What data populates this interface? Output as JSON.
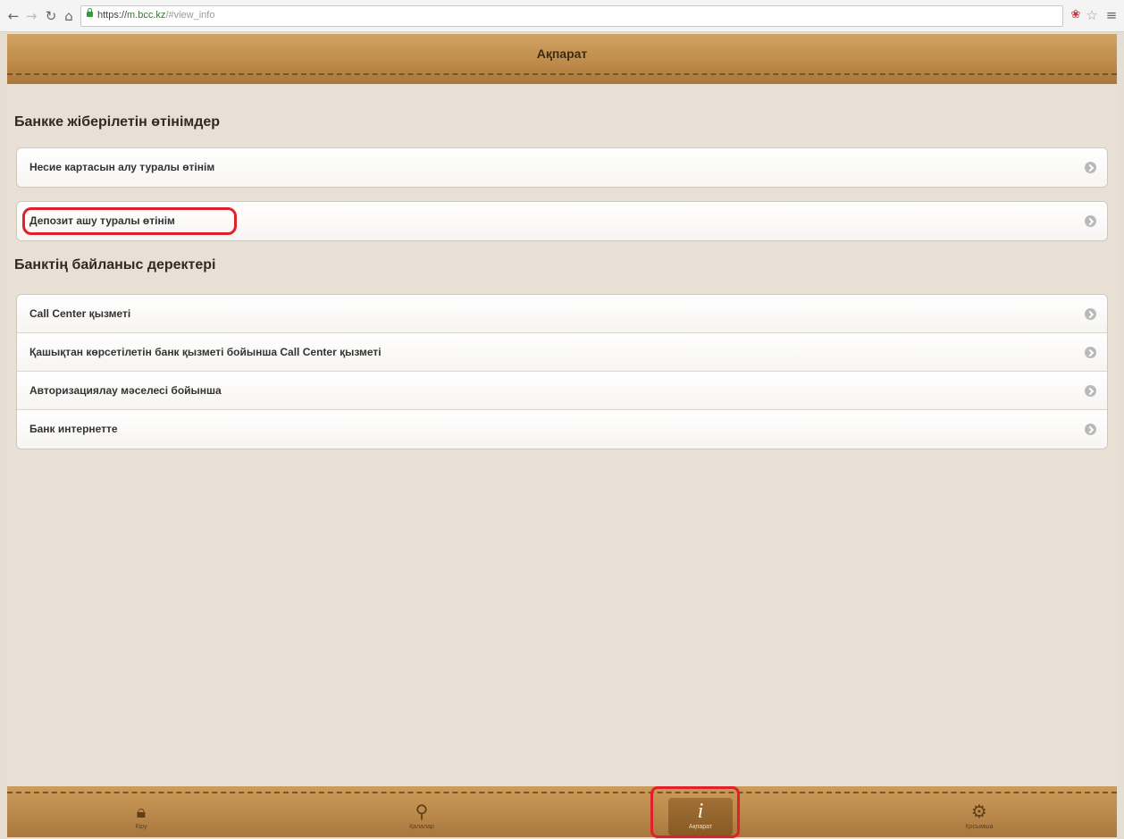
{
  "browser": {
    "url_scheme": "https://",
    "url_host": "m.bcc.kz",
    "url_path": "/#view_info",
    "icons": [
      "back-arrow-icon",
      "forward-arrow-icon",
      "reload-icon",
      "home-icon",
      "lock-icon",
      "extension-icon",
      "star-icon",
      "menu-icon"
    ]
  },
  "header": {
    "title": "Ақпарат"
  },
  "sections": [
    {
      "title": "Банкке жіберілетін өтінімдер",
      "items": [
        {
          "label": "Несие картасын алу туралы өтінім"
        },
        {
          "label": "Депозит ашу туралы өтінім"
        }
      ]
    },
    {
      "title": "Банктің байланыс деректері",
      "items": [
        {
          "label": "Call Center қызметі"
        },
        {
          "label": "Қашықтан көрсетілетін банк қызметі бойынша Call Center қызметі"
        },
        {
          "label": "Авторизациялау мәселесі бойынша"
        },
        {
          "label": "Банк интернетте"
        }
      ]
    }
  ],
  "tabs": [
    {
      "icon": "lock-icon",
      "label": "Кіру"
    },
    {
      "icon": "map-pin-icon",
      "label": "Қалалар"
    },
    {
      "icon": "info-icon",
      "label": "Ақпарат",
      "active": true
    },
    {
      "icon": "gear-icon",
      "label": "Қосымша"
    }
  ],
  "highlight_color": "#e0202a",
  "accent_color": "#bd8a49"
}
